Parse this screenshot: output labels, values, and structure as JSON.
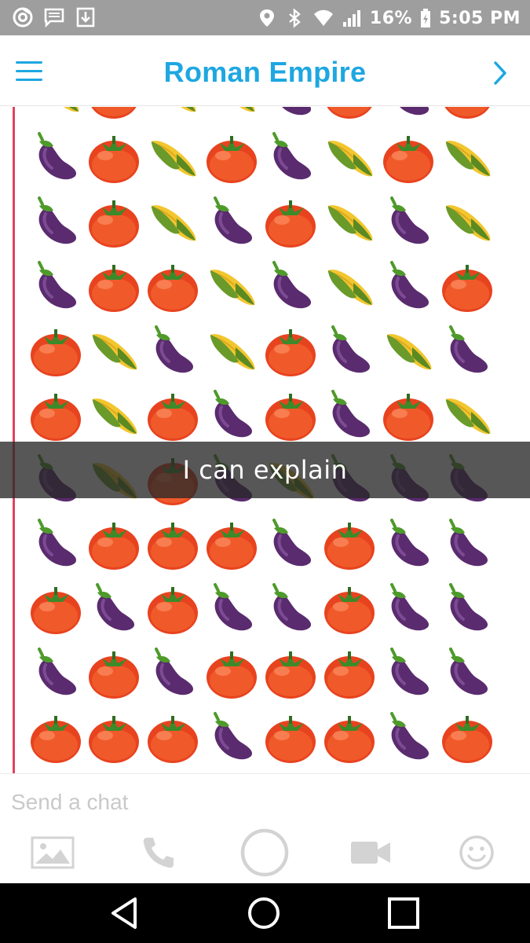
{
  "status_bar": {
    "battery": "16%",
    "time": "5:05 PM",
    "icons": [
      "chrome-icon",
      "message-icon",
      "download-icon",
      "location-icon",
      "bluetooth-icon",
      "wifi-icon",
      "signal-icon",
      "battery-icon"
    ]
  },
  "header": {
    "title": "Roman Empire",
    "accent": "#1ea7e1",
    "menu_icon": "hamburger-menu-icon",
    "forward_icon": "chevron-right-icon"
  },
  "chat": {
    "border_color": "#e2435f",
    "caption": "I can explain",
    "emoji_rows": [
      [
        "corn",
        "tomato",
        "corn",
        "corn",
        "eggplant",
        "tomato",
        "eggplant",
        "tomato"
      ],
      [
        "eggplant",
        "tomato",
        "corn",
        "tomato",
        "eggplant",
        "corn",
        "tomato",
        "corn"
      ],
      [
        "eggplant",
        "tomato",
        "corn",
        "eggplant",
        "tomato",
        "corn",
        "eggplant",
        "corn"
      ],
      [
        "eggplant",
        "tomato",
        "tomato",
        "corn",
        "eggplant",
        "corn",
        "eggplant",
        "tomato"
      ],
      [
        "tomato",
        "corn",
        "eggplant",
        "corn",
        "tomato",
        "eggplant",
        "corn",
        "eggplant"
      ],
      [
        "tomato",
        "corn",
        "tomato",
        "eggplant",
        "tomato",
        "eggplant",
        "tomato",
        "corn"
      ],
      [
        "eggplant",
        "corn",
        "tomato",
        "eggplant",
        "corn",
        "eggplant",
        "eggplant",
        "eggplant"
      ],
      [
        "eggplant",
        "tomato",
        "tomato",
        "tomato",
        "eggplant",
        "tomato",
        "eggplant",
        "eggplant"
      ],
      [
        "tomato",
        "eggplant",
        "tomato",
        "eggplant",
        "eggplant",
        "tomato",
        "eggplant",
        "eggplant"
      ],
      [
        "eggplant",
        "tomato",
        "eggplant",
        "tomato",
        "tomato",
        "tomato",
        "eggplant",
        "eggplant"
      ],
      [
        "tomato",
        "tomato",
        "tomato",
        "eggplant",
        "tomato",
        "tomato",
        "eggplant",
        "tomato"
      ]
    ]
  },
  "composer": {
    "placeholder": "Send a chat",
    "buttons": [
      "image-icon",
      "phone-icon",
      "capture-circle-icon",
      "video-camera-icon",
      "smiley-icon"
    ]
  },
  "nav_bar": {
    "buttons": [
      "back-triangle-icon",
      "home-circle-icon",
      "recents-square-icon"
    ]
  }
}
